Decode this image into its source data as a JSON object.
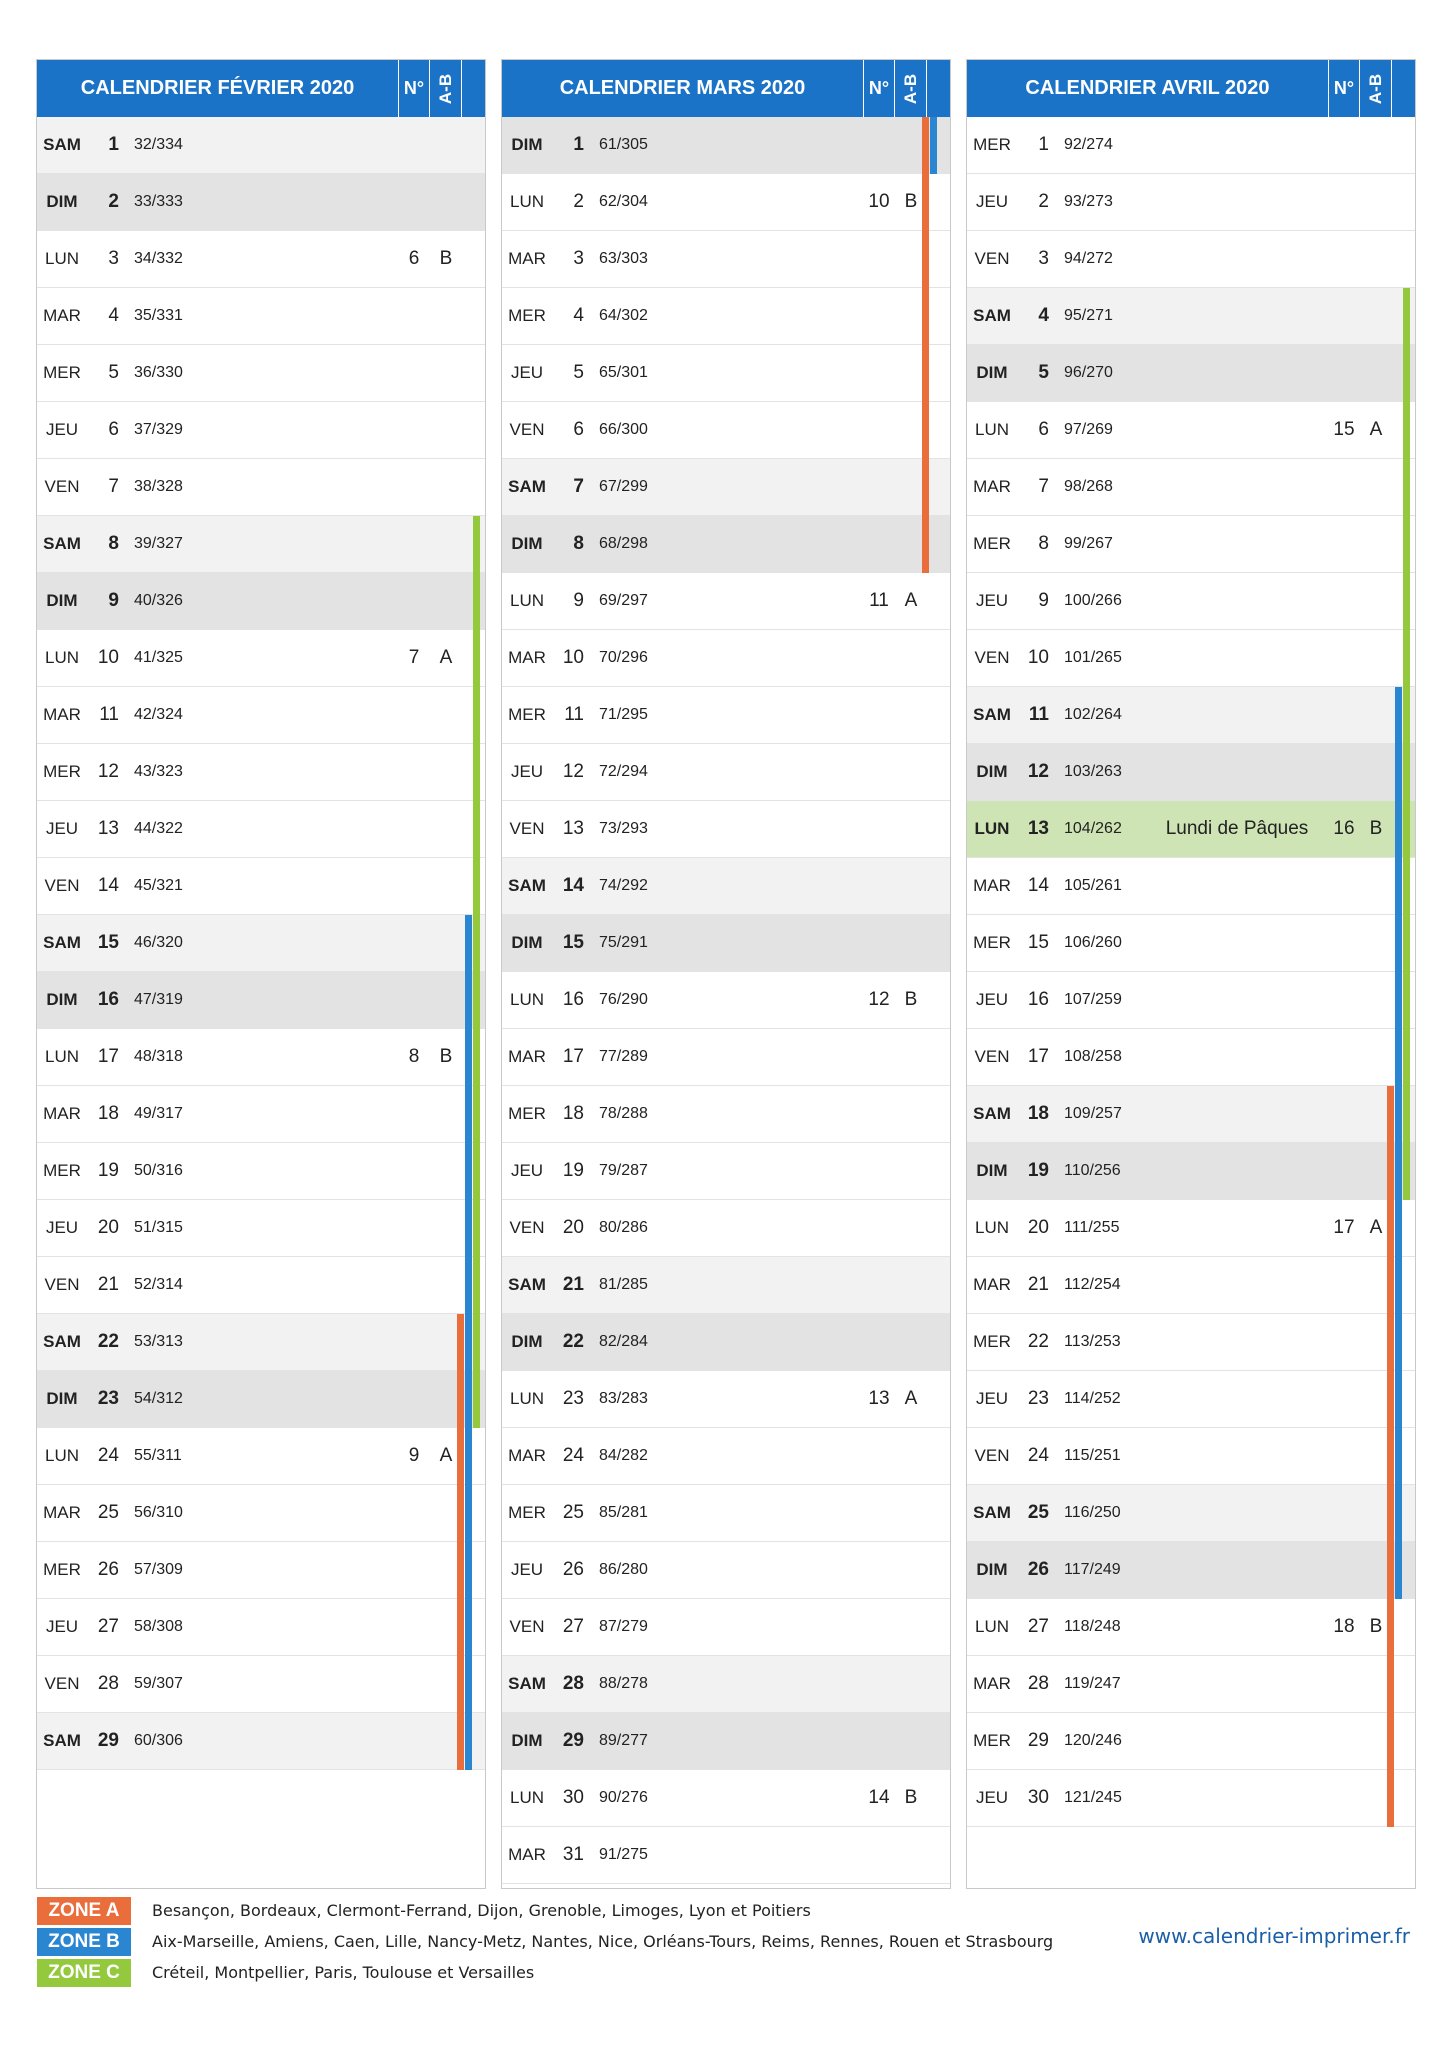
{
  "months": [
    {
      "title": "CALENDRIER FÉVRIER 2020",
      "week_header": "N°",
      "ab_header": "A-B",
      "days": [
        {
          "name": "SAM",
          "day": "1",
          "yday": "32/334",
          "kind": "sat",
          "zones": []
        },
        {
          "name": "DIM",
          "day": "2",
          "yday": "33/333",
          "kind": "sun",
          "zones": []
        },
        {
          "name": "LUN",
          "day": "3",
          "yday": "34/332",
          "week": "6",
          "ab": "B",
          "zones": []
        },
        {
          "name": "MAR",
          "day": "4",
          "yday": "35/331",
          "zones": []
        },
        {
          "name": "MER",
          "day": "5",
          "yday": "36/330",
          "zones": []
        },
        {
          "name": "JEU",
          "day": "6",
          "yday": "37/329",
          "zones": []
        },
        {
          "name": "VEN",
          "day": "7",
          "yday": "38/328",
          "zones": []
        },
        {
          "name": "SAM",
          "day": "8",
          "yday": "39/327",
          "kind": "sat",
          "zones": [
            "C"
          ]
        },
        {
          "name": "DIM",
          "day": "9",
          "yday": "40/326",
          "kind": "sun",
          "zones": [
            "C"
          ]
        },
        {
          "name": "LUN",
          "day": "10",
          "yday": "41/325",
          "week": "7",
          "ab": "A",
          "zones": [
            "C"
          ]
        },
        {
          "name": "MAR",
          "day": "11",
          "yday": "42/324",
          "zones": [
            "C"
          ]
        },
        {
          "name": "MER",
          "day": "12",
          "yday": "43/323",
          "zones": [
            "C"
          ]
        },
        {
          "name": "JEU",
          "day": "13",
          "yday": "44/322",
          "zones": [
            "C"
          ]
        },
        {
          "name": "VEN",
          "day": "14",
          "yday": "45/321",
          "zones": [
            "C"
          ]
        },
        {
          "name": "SAM",
          "day": "15",
          "yday": "46/320",
          "kind": "sat",
          "zones": [
            "B",
            "C"
          ]
        },
        {
          "name": "DIM",
          "day": "16",
          "yday": "47/319",
          "kind": "sun",
          "zones": [
            "B",
            "C"
          ]
        },
        {
          "name": "LUN",
          "day": "17",
          "yday": "48/318",
          "week": "8",
          "ab": "B",
          "zones": [
            "B",
            "C"
          ]
        },
        {
          "name": "MAR",
          "day": "18",
          "yday": "49/317",
          "zones": [
            "B",
            "C"
          ]
        },
        {
          "name": "MER",
          "day": "19",
          "yday": "50/316",
          "zones": [
            "B",
            "C"
          ]
        },
        {
          "name": "JEU",
          "day": "20",
          "yday": "51/315",
          "zones": [
            "B",
            "C"
          ]
        },
        {
          "name": "VEN",
          "day": "21",
          "yday": "52/314",
          "zones": [
            "B",
            "C"
          ]
        },
        {
          "name": "SAM",
          "day": "22",
          "yday": "53/313",
          "kind": "sat",
          "zones": [
            "A",
            "B",
            "C"
          ]
        },
        {
          "name": "DIM",
          "day": "23",
          "yday": "54/312",
          "kind": "sun",
          "zones": [
            "A",
            "B",
            "C"
          ]
        },
        {
          "name": "LUN",
          "day": "24",
          "yday": "55/311",
          "week": "9",
          "ab": "A",
          "zones": [
            "A",
            "B"
          ]
        },
        {
          "name": "MAR",
          "day": "25",
          "yday": "56/310",
          "zones": [
            "A",
            "B"
          ]
        },
        {
          "name": "MER",
          "day": "26",
          "yday": "57/309",
          "zones": [
            "A",
            "B"
          ]
        },
        {
          "name": "JEU",
          "day": "27",
          "yday": "58/308",
          "zones": [
            "A",
            "B"
          ]
        },
        {
          "name": "VEN",
          "day": "28",
          "yday": "59/307",
          "zones": [
            "A",
            "B"
          ]
        },
        {
          "name": "SAM",
          "day": "29",
          "yday": "60/306",
          "kind": "sat",
          "zones": [
            "A",
            "B"
          ]
        }
      ]
    },
    {
      "title": "CALENDRIER MARS 2020",
      "week_header": "N°",
      "ab_header": "A-B",
      "days": [
        {
          "name": "DIM",
          "day": "1",
          "yday": "61/305",
          "kind": "sun",
          "zones": [
            "A",
            "B"
          ]
        },
        {
          "name": "LUN",
          "day": "2",
          "yday": "62/304",
          "week": "10",
          "ab": "B",
          "zones": [
            "A"
          ]
        },
        {
          "name": "MAR",
          "day": "3",
          "yday": "63/303",
          "zones": [
            "A"
          ]
        },
        {
          "name": "MER",
          "day": "4",
          "yday": "64/302",
          "zones": [
            "A"
          ]
        },
        {
          "name": "JEU",
          "day": "5",
          "yday": "65/301",
          "zones": [
            "A"
          ]
        },
        {
          "name": "VEN",
          "day": "6",
          "yday": "66/300",
          "zones": [
            "A"
          ]
        },
        {
          "name": "SAM",
          "day": "7",
          "yday": "67/299",
          "kind": "sat",
          "zones": [
            "A"
          ]
        },
        {
          "name": "DIM",
          "day": "8",
          "yday": "68/298",
          "kind": "sun",
          "zones": [
            "A"
          ]
        },
        {
          "name": "LUN",
          "day": "9",
          "yday": "69/297",
          "week": "11",
          "ab": "A",
          "zones": []
        },
        {
          "name": "MAR",
          "day": "10",
          "yday": "70/296",
          "zones": []
        },
        {
          "name": "MER",
          "day": "11",
          "yday": "71/295",
          "zones": []
        },
        {
          "name": "JEU",
          "day": "12",
          "yday": "72/294",
          "zones": []
        },
        {
          "name": "VEN",
          "day": "13",
          "yday": "73/293",
          "zones": []
        },
        {
          "name": "SAM",
          "day": "14",
          "yday": "74/292",
          "kind": "sat",
          "zones": []
        },
        {
          "name": "DIM",
          "day": "15",
          "yday": "75/291",
          "kind": "sun",
          "zones": []
        },
        {
          "name": "LUN",
          "day": "16",
          "yday": "76/290",
          "week": "12",
          "ab": "B",
          "zones": []
        },
        {
          "name": "MAR",
          "day": "17",
          "yday": "77/289",
          "zones": []
        },
        {
          "name": "MER",
          "day": "18",
          "yday": "78/288",
          "zones": []
        },
        {
          "name": "JEU",
          "day": "19",
          "yday": "79/287",
          "zones": []
        },
        {
          "name": "VEN",
          "day": "20",
          "yday": "80/286",
          "zones": []
        },
        {
          "name": "SAM",
          "day": "21",
          "yday": "81/285",
          "kind": "sat",
          "zones": []
        },
        {
          "name": "DIM",
          "day": "22",
          "yday": "82/284",
          "kind": "sun",
          "zones": []
        },
        {
          "name": "LUN",
          "day": "23",
          "yday": "83/283",
          "week": "13",
          "ab": "A",
          "zones": []
        },
        {
          "name": "MAR",
          "day": "24",
          "yday": "84/282",
          "zones": []
        },
        {
          "name": "MER",
          "day": "25",
          "yday": "85/281",
          "zones": []
        },
        {
          "name": "JEU",
          "day": "26",
          "yday": "86/280",
          "zones": []
        },
        {
          "name": "VEN",
          "day": "27",
          "yday": "87/279",
          "zones": []
        },
        {
          "name": "SAM",
          "day": "28",
          "yday": "88/278",
          "kind": "sat",
          "zones": []
        },
        {
          "name": "DIM",
          "day": "29",
          "yday": "89/277",
          "kind": "sun",
          "zones": []
        },
        {
          "name": "LUN",
          "day": "30",
          "yday": "90/276",
          "week": "14",
          "ab": "B",
          "zones": []
        },
        {
          "name": "MAR",
          "day": "31",
          "yday": "91/275",
          "zones": []
        }
      ]
    },
    {
      "title": "CALENDRIER AVRIL 2020",
      "week_header": "N°",
      "ab_header": "A-B",
      "days": [
        {
          "name": "MER",
          "day": "1",
          "yday": "92/274",
          "zones": []
        },
        {
          "name": "JEU",
          "day": "2",
          "yday": "93/273",
          "zones": []
        },
        {
          "name": "VEN",
          "day": "3",
          "yday": "94/272",
          "zones": []
        },
        {
          "name": "SAM",
          "day": "4",
          "yday": "95/271",
          "kind": "sat",
          "zones": [
            "C"
          ]
        },
        {
          "name": "DIM",
          "day": "5",
          "yday": "96/270",
          "kind": "sun",
          "zones": [
            "C"
          ]
        },
        {
          "name": "LUN",
          "day": "6",
          "yday": "97/269",
          "week": "15",
          "ab": "A",
          "zones": [
            "C"
          ]
        },
        {
          "name": "MAR",
          "day": "7",
          "yday": "98/268",
          "zones": [
            "C"
          ]
        },
        {
          "name": "MER",
          "day": "8",
          "yday": "99/267",
          "zones": [
            "C"
          ]
        },
        {
          "name": "JEU",
          "day": "9",
          "yday": "100/266",
          "zones": [
            "C"
          ]
        },
        {
          "name": "VEN",
          "day": "10",
          "yday": "101/265",
          "zones": [
            "C"
          ]
        },
        {
          "name": "SAM",
          "day": "11",
          "yday": "102/264",
          "kind": "sat",
          "zones": [
            "B",
            "C"
          ]
        },
        {
          "name": "DIM",
          "day": "12",
          "yday": "103/263",
          "kind": "sun",
          "zones": [
            "B",
            "C"
          ]
        },
        {
          "name": "LUN",
          "day": "13",
          "yday": "104/262",
          "week": "16",
          "ab": "B",
          "holiday": "Lundi de Pâques",
          "kind": "holiday",
          "zones": [
            "B",
            "C"
          ]
        },
        {
          "name": "MAR",
          "day": "14",
          "yday": "105/261",
          "zones": [
            "B",
            "C"
          ]
        },
        {
          "name": "MER",
          "day": "15",
          "yday": "106/260",
          "zones": [
            "B",
            "C"
          ]
        },
        {
          "name": "JEU",
          "day": "16",
          "yday": "107/259",
          "zones": [
            "B",
            "C"
          ]
        },
        {
          "name": "VEN",
          "day": "17",
          "yday": "108/258",
          "zones": [
            "B",
            "C"
          ]
        },
        {
          "name": "SAM",
          "day": "18",
          "yday": "109/257",
          "kind": "sat",
          "zones": [
            "A",
            "B",
            "C"
          ]
        },
        {
          "name": "DIM",
          "day": "19",
          "yday": "110/256",
          "kind": "sun",
          "zones": [
            "A",
            "B",
            "C"
          ]
        },
        {
          "name": "LUN",
          "day": "20",
          "yday": "111/255",
          "week": "17",
          "ab": "A",
          "zones": [
            "A",
            "B"
          ]
        },
        {
          "name": "MAR",
          "day": "21",
          "yday": "112/254",
          "zones": [
            "A",
            "B"
          ]
        },
        {
          "name": "MER",
          "day": "22",
          "yday": "113/253",
          "zones": [
            "A",
            "B"
          ]
        },
        {
          "name": "JEU",
          "day": "23",
          "yday": "114/252",
          "zones": [
            "A",
            "B"
          ]
        },
        {
          "name": "VEN",
          "day": "24",
          "yday": "115/251",
          "zones": [
            "A",
            "B"
          ]
        },
        {
          "name": "SAM",
          "day": "25",
          "yday": "116/250",
          "kind": "sat",
          "zones": [
            "A",
            "B"
          ]
        },
        {
          "name": "DIM",
          "day": "26",
          "yday": "117/249",
          "kind": "sun",
          "zones": [
            "A",
            "B"
          ]
        },
        {
          "name": "LUN",
          "day": "27",
          "yday": "118/248",
          "week": "18",
          "ab": "B",
          "zones": [
            "A"
          ]
        },
        {
          "name": "MAR",
          "day": "28",
          "yday": "119/247",
          "zones": [
            "A"
          ]
        },
        {
          "name": "MER",
          "day": "29",
          "yday": "120/246",
          "zones": [
            "A"
          ]
        },
        {
          "name": "JEU",
          "day": "30",
          "yday": "121/245",
          "zones": [
            "A"
          ]
        }
      ]
    }
  ],
  "legend": [
    {
      "zone": "A",
      "label": "ZONE A",
      "color": "#ea6d3c",
      "text": "Besançon, Bordeaux, Clermont-Ferrand, Dijon, Grenoble, Limoges, Lyon et Poitiers"
    },
    {
      "zone": "B",
      "label": "ZONE B",
      "color": "#2b86d2",
      "text": "Aix-Marseille, Amiens, Caen, Lille, Nancy-Metz, Nantes, Nice, Orléans-Tours, Reims, Rennes, Rouen et Strasbourg"
    },
    {
      "zone": "C",
      "label": "ZONE C",
      "color": "#95c93d",
      "text": "Créteil, Montpellier, Paris, Toulouse et Versailles"
    }
  ],
  "website": "www.calendrier-imprimer.fr"
}
